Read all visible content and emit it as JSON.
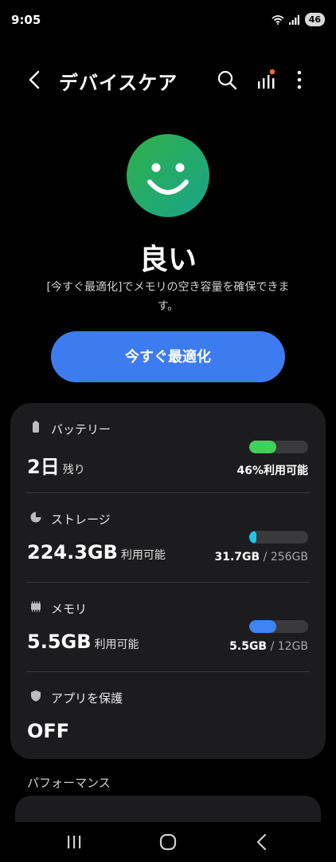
{
  "status_bar": {
    "time": "9:05",
    "battery": "46",
    "icons": [
      "wifi-icon",
      "signal-icon",
      "battery-icon"
    ]
  },
  "header": {
    "title": "デバイスケア",
    "icons": [
      "back-icon",
      "search-icon",
      "diagnostics-icon",
      "more-icon"
    ],
    "notification_dot_color": "#ff6a2c"
  },
  "hero": {
    "status": "良い",
    "description": "[今すぐ最適化]でメモリの空き容量を確保できます。",
    "face_colors": [
      "#2fb24a",
      "#1aa38a"
    ]
  },
  "optimize_button": {
    "label": "今すぐ最適化",
    "color": "#3d7cf0"
  },
  "sections": {
    "battery": {
      "label": "バッテリー",
      "value": "2日",
      "suffix": "残り",
      "caption": "46%利用可能",
      "level": 0.46,
      "color": "#3ed15b",
      "icon": "battery-icon"
    },
    "storage": {
      "label": "ストレージ",
      "value": "224.3GB",
      "suffix": "利用可能",
      "used": "31.7GB",
      "total": "/ 256GB",
      "level": 0.12,
      "color": "#25c3e8",
      "icon": "pie-chart-icon"
    },
    "memory": {
      "label": "メモリ",
      "value": "5.5GB",
      "suffix": "利用可能",
      "used": "5.5GB",
      "total": "/ 12GB",
      "level": 0.46,
      "color": "#3f84f3",
      "icon": "memory-chip-icon"
    },
    "app_protection": {
      "label": "アプリを保護",
      "value": "OFF",
      "icon": "shield-icon"
    }
  },
  "performance": {
    "label": "パフォーマンス"
  },
  "nav_bar": {
    "icons": [
      "recents-icon",
      "home-icon",
      "back-nav-icon"
    ]
  }
}
